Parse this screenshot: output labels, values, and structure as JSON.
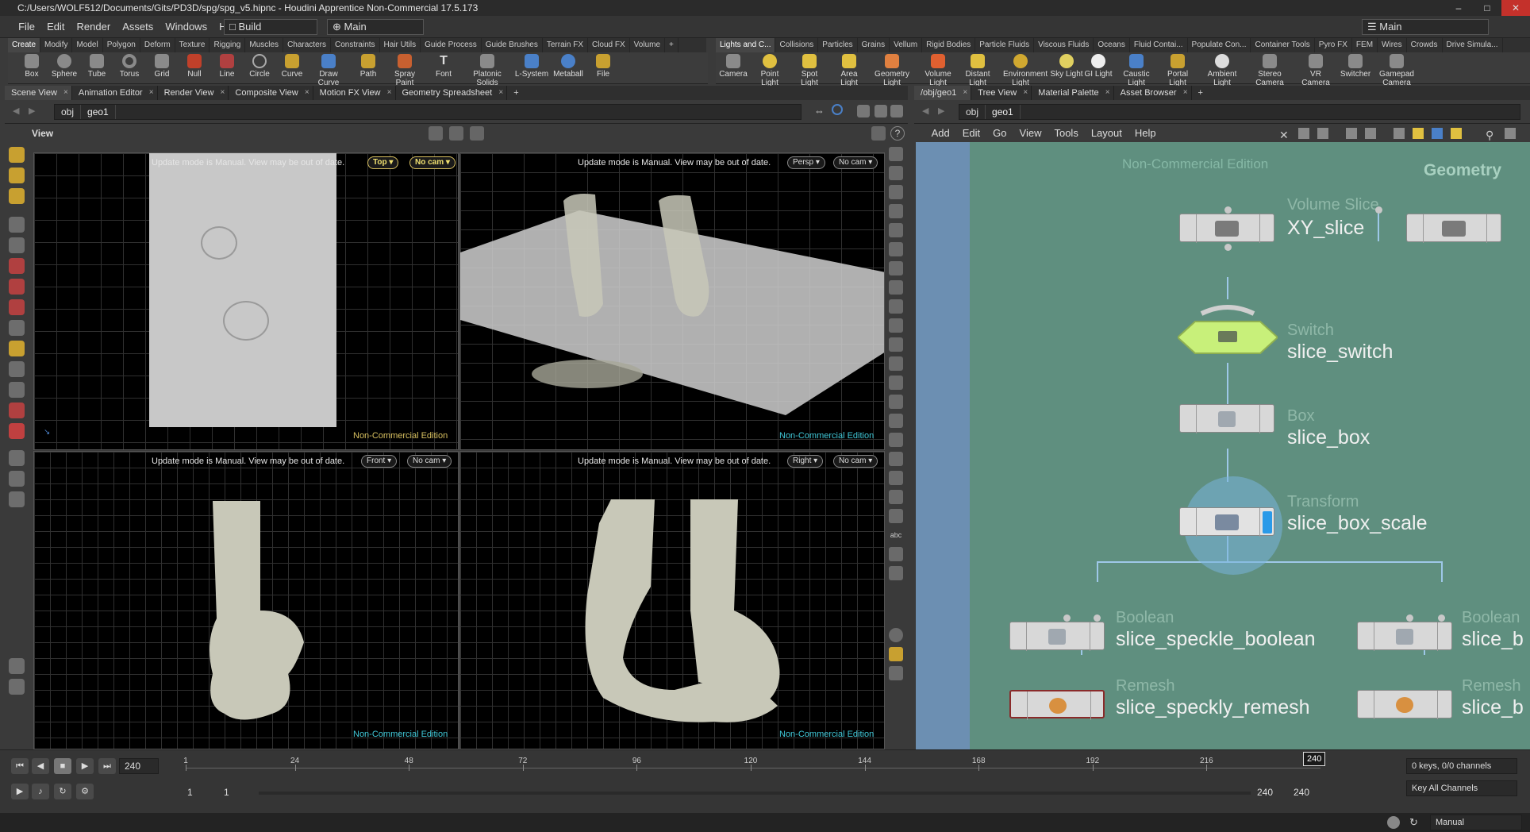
{
  "window": {
    "title": "C:/Users/WOLF512/Documents/Gits/PD3D/spg/spg_v5.hipnc - Houdini Apprentice Non-Commercial 17.5.173"
  },
  "menubar": {
    "items": [
      "File",
      "Edit",
      "Render",
      "Assets",
      "Windows",
      "Help"
    ],
    "desk": "Build",
    "desk_main": "Main",
    "right_desk": "Main"
  },
  "shelf": {
    "left_tabs": [
      "Create",
      "Modify",
      "Model",
      "Polygon",
      "Deform",
      "Texture",
      "Rigging",
      "Muscles",
      "Characters",
      "Constraints",
      "Hair Utils",
      "Guide Process",
      "Guide Brushes",
      "Terrain FX",
      "Cloud FX",
      "Volume"
    ],
    "right_tabs": [
      "Lights and C...",
      "Collisions",
      "Particles",
      "Grains",
      "Vellum",
      "Rigid Bodies",
      "Particle Fluids",
      "Viscous Fluids",
      "Oceans",
      "Fluid Contai...",
      "Populate Con...",
      "Container Tools",
      "Pyro FX",
      "FEM",
      "Wires",
      "Crowds",
      "Drive Simula..."
    ],
    "left_tools": [
      "Box",
      "Sphere",
      "Tube",
      "Torus",
      "Grid",
      "Null",
      "Line",
      "Circle",
      "Curve",
      "Draw Curve",
      "Path",
      "Spray Paint",
      "Font",
      "Platonic Solids",
      "L-System",
      "Metaball",
      "File"
    ],
    "right_tools": [
      "Camera",
      "Point Light",
      "Spot Light",
      "Area Light",
      "Geometry Light",
      "Volume Light",
      "Distant Light",
      "Environment Light",
      "Sky Light",
      "GI Light",
      "Caustic Light",
      "Portal Light",
      "Ambient Light",
      "Stereo Camera",
      "VR Camera",
      "Switcher",
      "Gamepad Camera"
    ]
  },
  "left_pane": {
    "tabs": [
      "Scene View",
      "Animation Editor",
      "Render View",
      "Composite View",
      "Motion FX View",
      "Geometry Spreadsheet"
    ],
    "path": [
      "obj",
      "geo1"
    ],
    "view_label": "View",
    "viewports": [
      {
        "msg": "Update mode is Manual. View may be out of date.",
        "view": "Top",
        "cam": "No cam",
        "watermark": "Non-Commercial Edition"
      },
      {
        "msg": "Update mode is Manual. View may be out of date.",
        "view": "Persp",
        "cam": "No cam",
        "watermark": "Non-Commercial Edition"
      },
      {
        "msg": "Update mode is Manual. View may be out of date.",
        "view": "Front",
        "cam": "No cam",
        "watermark": "Non-Commercial Edition"
      },
      {
        "msg": "Update mode is Manual. View may be out of date.",
        "view": "Right",
        "cam": "No cam",
        "watermark": "Non-Commercial Edition"
      }
    ]
  },
  "right_pane": {
    "tabs": [
      "/obj/geo1",
      "Tree View",
      "Material Palette",
      "Asset Browser"
    ],
    "path": [
      "obj",
      "geo1"
    ],
    "menu": [
      "Add",
      "Edit",
      "Go",
      "View",
      "Tools",
      "Layout",
      "Help"
    ],
    "watermark": "Non-Commercial Edition",
    "context": "Geometry",
    "nodes": [
      {
        "type": "Volume Slice",
        "name": "XY_slice"
      },
      {
        "type": "Switch",
        "name": "slice_switch"
      },
      {
        "type": "Box",
        "name": "slice_box"
      },
      {
        "type": "Transform",
        "name": "slice_box_scale"
      },
      {
        "type": "Boolean",
        "name": "slice_speckle_boolean"
      },
      {
        "type": "Remesh",
        "name": "slice_speckly_remesh"
      },
      {
        "type": "Boolean",
        "name": "slice_b"
      },
      {
        "type": "Remesh",
        "name": "slice_b"
      }
    ]
  },
  "timeline": {
    "current_frame": "240",
    "ticks": [
      "1",
      "24",
      "48",
      "72",
      "96",
      "120",
      "144",
      "168",
      "192",
      "216"
    ],
    "range_start": "1",
    "range_start2": "1",
    "range_end": "240",
    "range_end2": "240",
    "marker": "240",
    "keys": "0 keys, 0/0 channels",
    "key_all": "Key All Channels",
    "update": "Manual"
  }
}
